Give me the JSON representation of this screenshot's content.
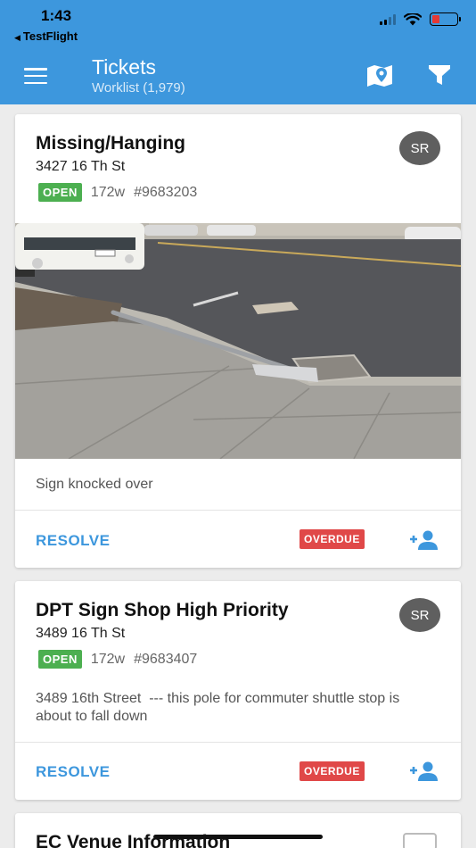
{
  "status_bar": {
    "time": "1:43",
    "back_app": "TestFlight",
    "signal_icon": "signal-icon",
    "wifi_icon": "wifi-icon",
    "battery_icon": "battery-low-icon"
  },
  "app_bar": {
    "title": "Tickets",
    "subtitle": "Worklist (1,979)",
    "menu_icon": "menu-icon",
    "map_icon": "map-marker-icon",
    "filter_icon": "filter-icon",
    "color": "#3d97dd"
  },
  "tickets": [
    {
      "title": "Missing/Hanging",
      "address": "3427 16 Th St",
      "status": "OPEN",
      "age": "172w",
      "number": "#9683203",
      "assignee_initials": "SR",
      "has_photo": true,
      "description": "Sign knocked over",
      "action": "RESOLVE",
      "due_badge": "OVERDUE"
    },
    {
      "title": "DPT Sign Shop High Priority",
      "address": "3489 16 Th St",
      "status": "OPEN",
      "age": "172w",
      "number": "#9683407",
      "assignee_initials": "SR",
      "has_photo": false,
      "description": "3489 16th Street  --- this pole for commuter shuttle stop is about to fall down",
      "action": "RESOLVE",
      "due_badge": "OVERDUE"
    },
    {
      "title": "EC Venue Information",
      "icon": "keyboard-icon"
    }
  ],
  "colors": {
    "open_badge": "#4caf50",
    "overdue_badge": "#e04848",
    "accent": "#3d97dd"
  }
}
